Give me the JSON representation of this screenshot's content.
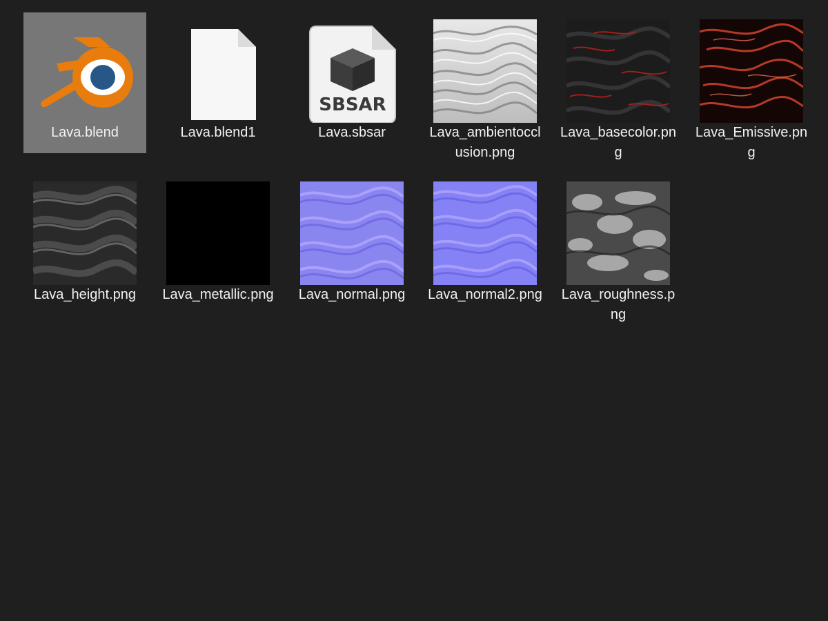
{
  "files": [
    {
      "name": "Lava.blend",
      "icon": "blender-file-icon",
      "selected": true
    },
    {
      "name": "Lava.blend1",
      "icon": "blank-document-icon",
      "selected": false
    },
    {
      "name": "Lava.sbsar",
      "icon": "sbsar-file-icon",
      "icon_text": "SBSAR",
      "selected": false
    },
    {
      "name": "Lava_ambientocclusion.png",
      "icon": "ambient-occlusion-thumbnail",
      "selected": false
    },
    {
      "name": "Lava_basecolor.png",
      "icon": "basecolor-thumbnail",
      "selected": false
    },
    {
      "name": "Lava_Emissive.png",
      "icon": "emissive-thumbnail",
      "selected": false
    },
    {
      "name": "Lava_height.png",
      "icon": "height-thumbnail",
      "selected": false
    },
    {
      "name": "Lava_metallic.png",
      "icon": "metallic-thumbnail",
      "selected": false
    },
    {
      "name": "Lava_normal.png",
      "icon": "normal-thumbnail",
      "selected": false
    },
    {
      "name": "Lava_normal2.png",
      "icon": "normal2-thumbnail",
      "selected": false
    },
    {
      "name": "Lava_roughness.png",
      "icon": "roughness-thumbnail",
      "selected": false
    }
  ],
  "colors": {
    "background": "#1f1f1f",
    "selection": "#777777",
    "label_text": "#f2f2f2",
    "blender_orange": "#e87d0d",
    "blender_blue": "#265787",
    "normal_map_base": "#8080ff",
    "emissive_red": "#c8402a"
  }
}
